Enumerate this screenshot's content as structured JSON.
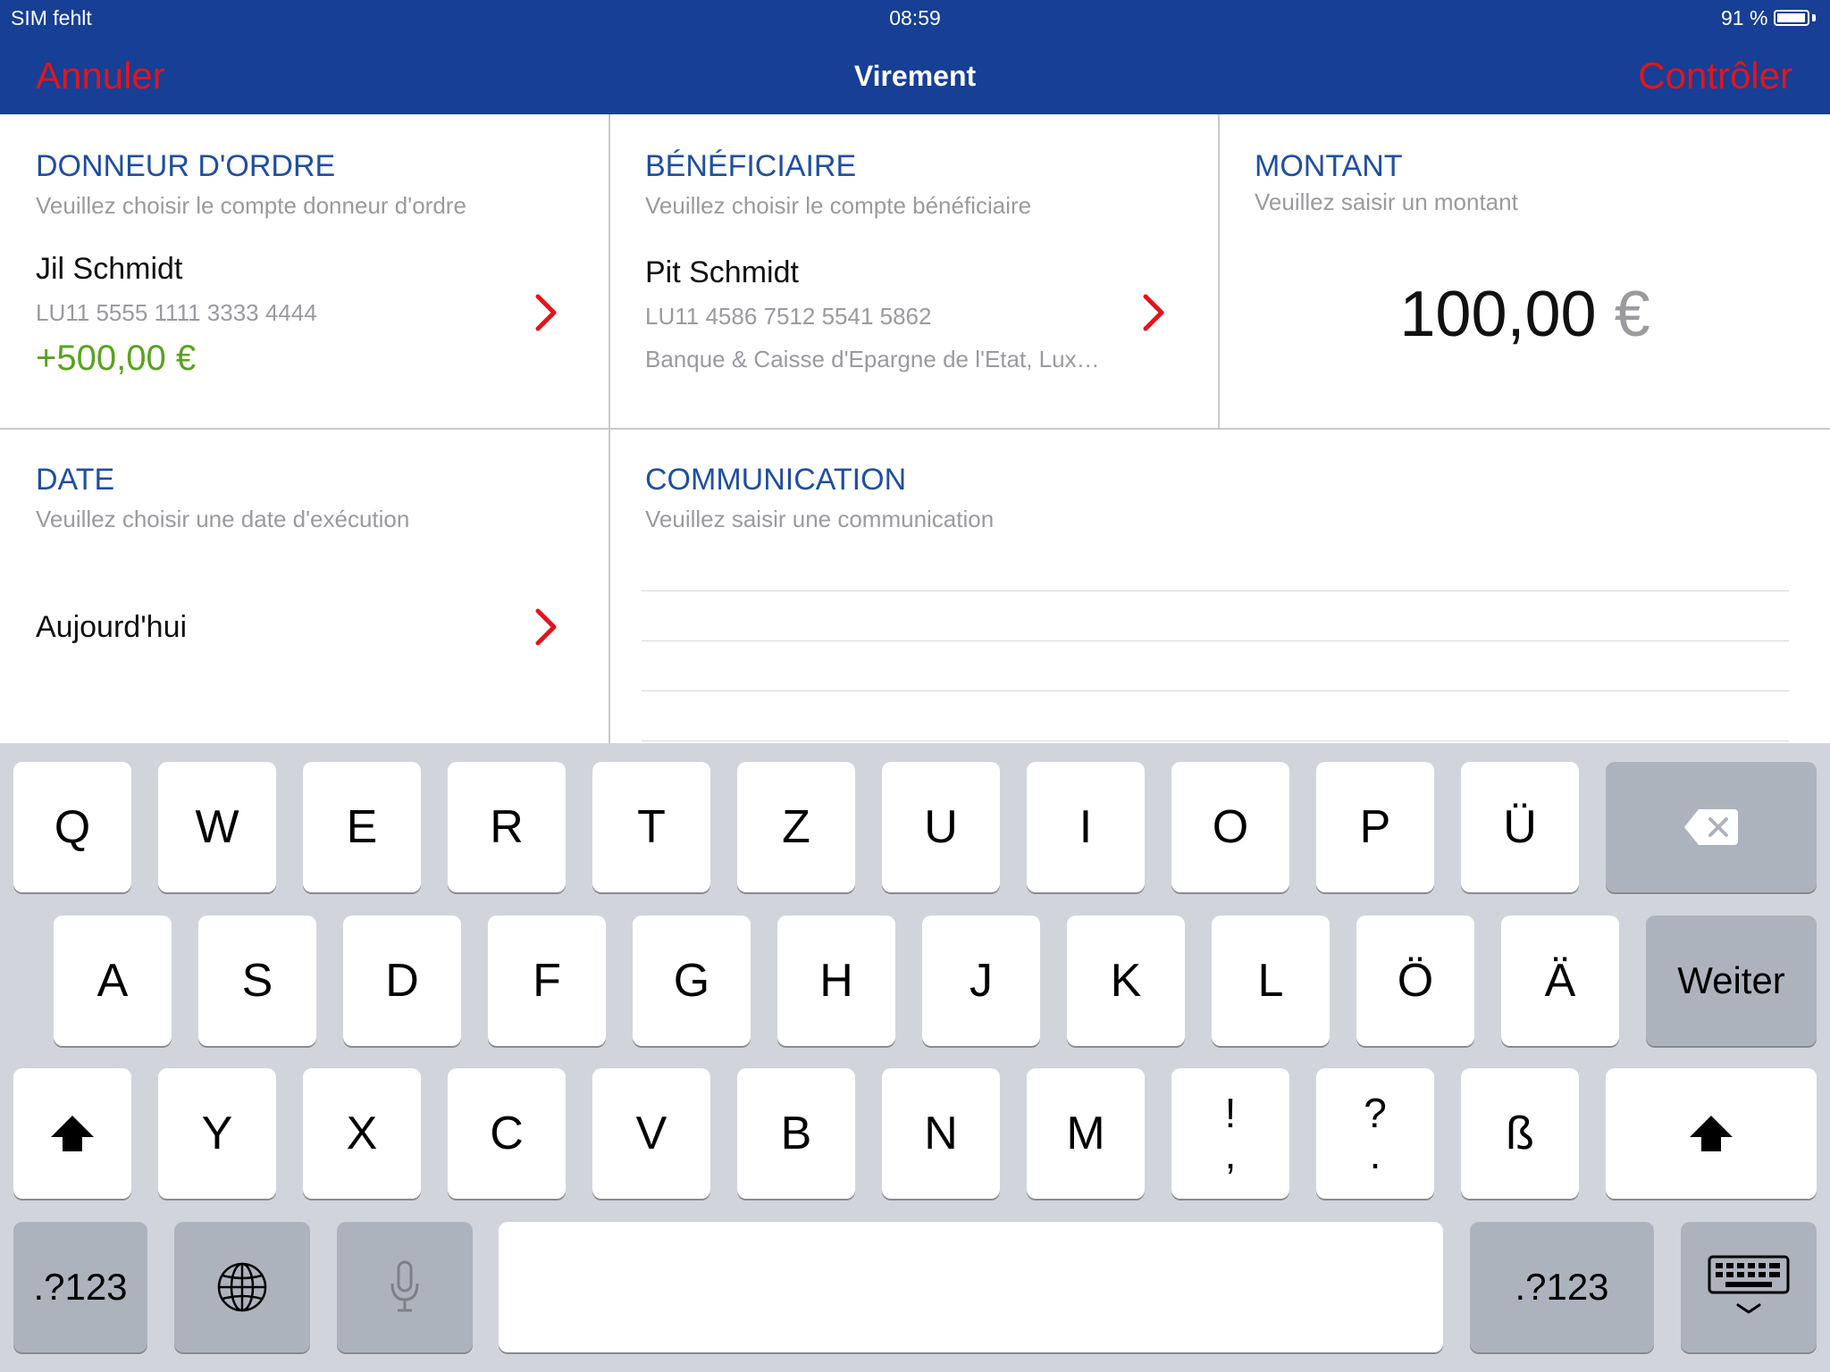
{
  "status_bar": {
    "carrier": "SIM fehlt",
    "time": "08:59",
    "battery": "91 %",
    "battery_level": 0.91
  },
  "nav": {
    "cancel": "Annuler",
    "title": "Virement",
    "check": "Contrôler"
  },
  "colors": {
    "nav_bg": "#163f95",
    "accent_red": "#e4141b",
    "section_blue": "#1f4ea3",
    "positive_green": "#5aa21f"
  },
  "sender": {
    "title": "DONNEUR D'ORDRE",
    "hint": "Veuillez choisir le compte donneur d'ordre",
    "name": "Jil Schmidt",
    "iban": "LU11 5555 1111 3333 4444",
    "balance": "+500,00 €",
    "icon": "chevron-right-icon"
  },
  "beneficiary": {
    "title": "BÉNÉFICIAIRE",
    "hint": "Veuillez choisir le compte bénéficiaire",
    "name": "Pit Schmidt",
    "iban": "LU11 4586 7512 5541 5862",
    "bank": "Banque & Caisse d'Epargne de l'Etat, Lux…",
    "icon": "chevron-right-icon"
  },
  "amount": {
    "title": "MONTANT",
    "hint": "Veuillez saisir un montant",
    "value": "100,00",
    "currency": "€"
  },
  "date": {
    "title": "DATE",
    "hint": "Veuillez choisir une date d'exécution",
    "value": "Aujourd'hui",
    "icon": "chevron-right-icon"
  },
  "communication": {
    "title": "COMMUNICATION",
    "hint": "Veuillez saisir une communication"
  },
  "keyboard": {
    "row1": [
      "Q",
      "W",
      "E",
      "R",
      "T",
      "Z",
      "U",
      "I",
      "O",
      "P",
      "Ü"
    ],
    "row2": [
      "A",
      "S",
      "D",
      "F",
      "G",
      "H",
      "J",
      "K",
      "L",
      "Ö",
      "Ä"
    ],
    "return_label": "Weiter",
    "row3": [
      "Y",
      "X",
      "C",
      "V",
      "B",
      "N",
      "M"
    ],
    "punct1": {
      "top": "!",
      "bottom": ","
    },
    "punct2": {
      "top": "?",
      "bottom": "."
    },
    "eszett": "ß",
    "numbers_label": ".?123",
    "icons": [
      "backspace-icon",
      "shift-icon",
      "globe-icon",
      "microphone-icon",
      "keyboard-dismiss-icon"
    ]
  }
}
